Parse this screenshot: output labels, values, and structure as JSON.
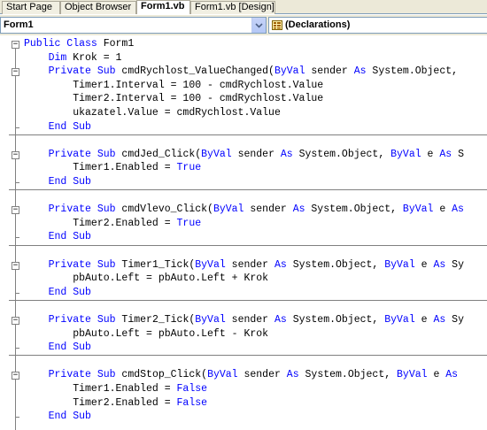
{
  "tabs": [
    {
      "label": "Start Page",
      "active": false
    },
    {
      "label": "Object Browser",
      "active": false
    },
    {
      "label": "Form1.vb",
      "active": true
    },
    {
      "label": "Form1.vb [Design]",
      "active": false
    }
  ],
  "class_combo": {
    "value": "Form1",
    "icon": "class-icon"
  },
  "method_combo": {
    "value": "(Declarations)",
    "icon": "declarations-icon"
  },
  "colors": {
    "keyword": "#0000ff",
    "text": "#000000",
    "separator": "#808080"
  },
  "code_lines": [
    [
      {
        "k": 1,
        "t": "Public Class"
      },
      {
        "t": " Form1"
      }
    ],
    [
      {
        "t": "    "
      },
      {
        "k": 1,
        "t": "Dim"
      },
      {
        "t": " Krok = 1"
      }
    ],
    [
      {
        "t": "    "
      },
      {
        "k": 1,
        "t": "Private Sub"
      },
      {
        "t": " cmdRychlost_ValueChanged("
      },
      {
        "k": 1,
        "t": "ByVal"
      },
      {
        "t": " sender "
      },
      {
        "k": 1,
        "t": "As"
      },
      {
        "t": " System.Object,"
      }
    ],
    [
      {
        "t": "        Timer1.Interval = 100 - cmdRychlost.Value"
      }
    ],
    [
      {
        "t": "        Timer2.Interval = 100 - cmdRychlost.Value"
      }
    ],
    [
      {
        "t": "        ukazatel.Value = cmdRychlost.Value"
      }
    ],
    [
      {
        "t": "    "
      },
      {
        "k": 1,
        "t": "End Sub"
      }
    ],
    [
      {
        "t": ""
      }
    ],
    [
      {
        "t": "    "
      },
      {
        "k": 1,
        "t": "Private Sub"
      },
      {
        "t": " cmdJed_Click("
      },
      {
        "k": 1,
        "t": "ByVal"
      },
      {
        "t": " sender "
      },
      {
        "k": 1,
        "t": "As"
      },
      {
        "t": " System.Object, "
      },
      {
        "k": 1,
        "t": "ByVal"
      },
      {
        "t": " e "
      },
      {
        "k": 1,
        "t": "As"
      },
      {
        "t": " S"
      }
    ],
    [
      {
        "t": "        Timer1.Enabled = "
      },
      {
        "k": 1,
        "t": "True"
      }
    ],
    [
      {
        "t": "    "
      },
      {
        "k": 1,
        "t": "End Sub"
      }
    ],
    [
      {
        "t": ""
      }
    ],
    [
      {
        "t": "    "
      },
      {
        "k": 1,
        "t": "Private Sub"
      },
      {
        "t": " cmdVlevo_Click("
      },
      {
        "k": 1,
        "t": "ByVal"
      },
      {
        "t": " sender "
      },
      {
        "k": 1,
        "t": "As"
      },
      {
        "t": " System.Object, "
      },
      {
        "k": 1,
        "t": "ByVal"
      },
      {
        "t": " e "
      },
      {
        "k": 1,
        "t": "As"
      }
    ],
    [
      {
        "t": "        Timer2.Enabled = "
      },
      {
        "k": 1,
        "t": "True"
      }
    ],
    [
      {
        "t": "    "
      },
      {
        "k": 1,
        "t": "End Sub"
      }
    ],
    [
      {
        "t": ""
      }
    ],
    [
      {
        "t": "    "
      },
      {
        "k": 1,
        "t": "Private Sub"
      },
      {
        "t": " Timer1_Tick("
      },
      {
        "k": 1,
        "t": "ByVal"
      },
      {
        "t": " sender "
      },
      {
        "k": 1,
        "t": "As"
      },
      {
        "t": " System.Object, "
      },
      {
        "k": 1,
        "t": "ByVal"
      },
      {
        "t": " e "
      },
      {
        "k": 1,
        "t": "As"
      },
      {
        "t": " Sy"
      }
    ],
    [
      {
        "t": "        pbAuto.Left = pbAuto.Left + Krok"
      }
    ],
    [
      {
        "t": "    "
      },
      {
        "k": 1,
        "t": "End Sub"
      }
    ],
    [
      {
        "t": ""
      }
    ],
    [
      {
        "t": "    "
      },
      {
        "k": 1,
        "t": "Private Sub"
      },
      {
        "t": " Timer2_Tick("
      },
      {
        "k": 1,
        "t": "ByVal"
      },
      {
        "t": " sender "
      },
      {
        "k": 1,
        "t": "As"
      },
      {
        "t": " System.Object, "
      },
      {
        "k": 1,
        "t": "ByVal"
      },
      {
        "t": " e "
      },
      {
        "k": 1,
        "t": "As"
      },
      {
        "t": " Sy"
      }
    ],
    [
      {
        "t": "        pbAuto.Left = pbAuto.Left - Krok"
      }
    ],
    [
      {
        "t": "    "
      },
      {
        "k": 1,
        "t": "End Sub"
      }
    ],
    [
      {
        "t": ""
      }
    ],
    [
      {
        "t": "    "
      },
      {
        "k": 1,
        "t": "Private Sub"
      },
      {
        "t": " cmdStop_Click("
      },
      {
        "k": 1,
        "t": "ByVal"
      },
      {
        "t": " sender "
      },
      {
        "k": 1,
        "t": "As"
      },
      {
        "t": " System.Object, "
      },
      {
        "k": 1,
        "t": "ByVal"
      },
      {
        "t": " e "
      },
      {
        "k": 1,
        "t": "As"
      }
    ],
    [
      {
        "t": "        Timer1.Enabled = "
      },
      {
        "k": 1,
        "t": "False"
      }
    ],
    [
      {
        "t": "        Timer2.Enabled = "
      },
      {
        "k": 1,
        "t": "False"
      }
    ],
    [
      {
        "t": "    "
      },
      {
        "k": 1,
        "t": "End Sub"
      }
    ]
  ]
}
